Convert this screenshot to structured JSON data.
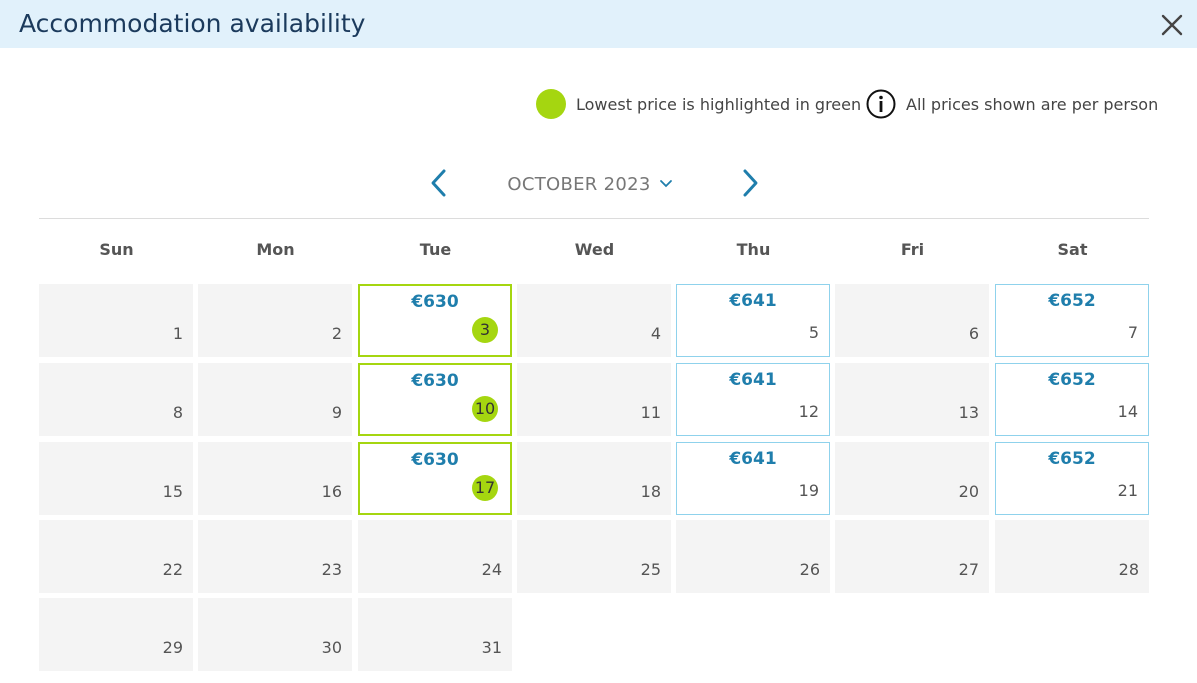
{
  "header": {
    "title": "Accommodation availability"
  },
  "legend": {
    "lowest_price_text": "Lowest price is highlighted in green",
    "per_person_text": "All prices shown are per person",
    "green": "#a5d610"
  },
  "calendar": {
    "month_label": "OCTOBER 2023",
    "weekdays": [
      "Sun",
      "Mon",
      "Tue",
      "Wed",
      "Thu",
      "Fri",
      "Sat"
    ],
    "first_weekday_index": 0,
    "days": [
      {
        "day": "1"
      },
      {
        "day": "2"
      },
      {
        "day": "3",
        "price": "€630",
        "status": "lowest"
      },
      {
        "day": "4"
      },
      {
        "day": "5",
        "price": "€641",
        "status": "available"
      },
      {
        "day": "6"
      },
      {
        "day": "7",
        "price": "€652",
        "status": "available"
      },
      {
        "day": "8"
      },
      {
        "day": "9"
      },
      {
        "day": "10",
        "price": "€630",
        "status": "lowest"
      },
      {
        "day": "11"
      },
      {
        "day": "12",
        "price": "€641",
        "status": "available"
      },
      {
        "day": "13"
      },
      {
        "day": "14",
        "price": "€652",
        "status": "available"
      },
      {
        "day": "15"
      },
      {
        "day": "16"
      },
      {
        "day": "17",
        "price": "€630",
        "status": "lowest"
      },
      {
        "day": "18"
      },
      {
        "day": "19",
        "price": "€641",
        "status": "available"
      },
      {
        "day": "20"
      },
      {
        "day": "21",
        "price": "€652",
        "status": "available"
      },
      {
        "day": "22"
      },
      {
        "day": "23"
      },
      {
        "day": "24"
      },
      {
        "day": "25"
      },
      {
        "day": "26"
      },
      {
        "day": "27"
      },
      {
        "day": "28"
      },
      {
        "day": "29"
      },
      {
        "day": "30"
      },
      {
        "day": "31"
      }
    ]
  },
  "colors": {
    "accent_blue": "#1f7eac",
    "available_border": "#8fd2ec",
    "header_bg": "#e1f1fb"
  },
  "icons": {
    "close": "close-icon",
    "info": "info-icon",
    "prev": "chevron-left-icon",
    "next": "chevron-right-icon"
  }
}
